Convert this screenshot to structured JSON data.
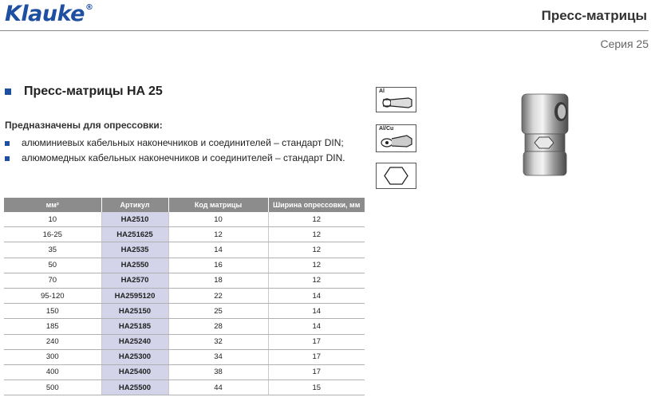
{
  "brand": "Klauke",
  "brand_mark": "®",
  "header": {
    "title": "Пресс-матрицы",
    "series": "Серия 25"
  },
  "section": {
    "title": "Пресс-матрицы HA 25",
    "purpose_label": "Предназначены для опрессовки:",
    "items": [
      "алюминиевых кабельных наконечников и соединителей – стандарт DIN;",
      "алюмомедных кабельных наконечников и соединителей – стандарт DIN."
    ]
  },
  "icons": [
    {
      "name": "aluminium-lug-icon",
      "label": "Al"
    },
    {
      "name": "al-cu-lug-icon",
      "label": "Al/Cu"
    },
    {
      "name": "hexagon-crimp-icon",
      "label": ""
    }
  ],
  "table": {
    "columns": [
      "мм²",
      "Артикул",
      "Код матрицы",
      "Ширина опрессовки, мм"
    ],
    "rows": [
      [
        "10",
        "HA2510",
        "10",
        "12"
      ],
      [
        "16-25",
        "HA251625",
        "12",
        "12"
      ],
      [
        "35",
        "HA2535",
        "14",
        "12"
      ],
      [
        "50",
        "HA2550",
        "16",
        "12"
      ],
      [
        "70",
        "HA2570",
        "18",
        "12"
      ],
      [
        "95-120",
        "HA2595120",
        "22",
        "14"
      ],
      [
        "150",
        "HA25150",
        "25",
        "14"
      ],
      [
        "185",
        "HA25185",
        "28",
        "14"
      ],
      [
        "240",
        "HA25240",
        "32",
        "17"
      ],
      [
        "300",
        "HA25300",
        "34",
        "17"
      ],
      [
        "400",
        "HA25400",
        "38",
        "17"
      ],
      [
        "500",
        "HA25500",
        "44",
        "15"
      ]
    ]
  },
  "colors": {
    "brand_blue": "#1e4fa0",
    "header_gray": "#8c8c8c",
    "article_bg": "#d3d3ea"
  }
}
